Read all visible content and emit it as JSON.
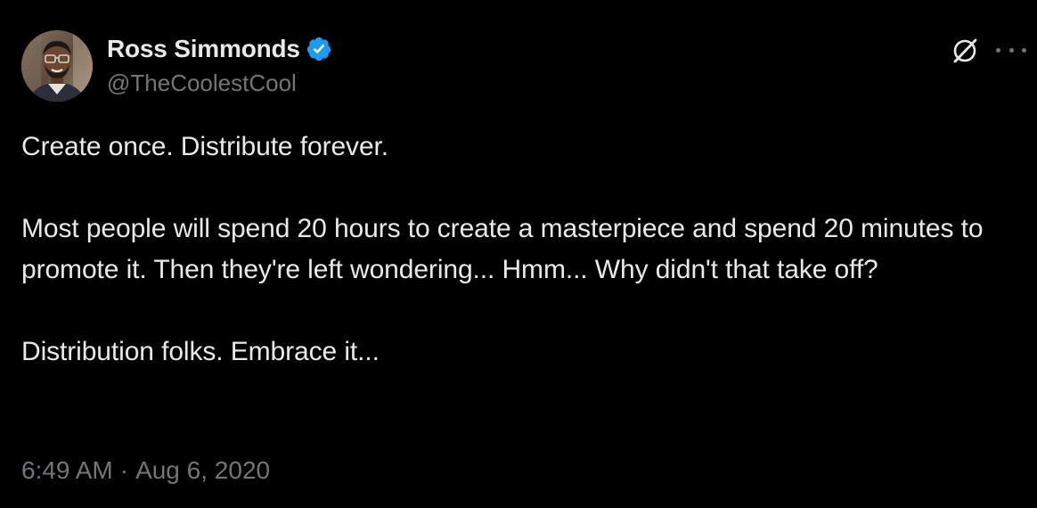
{
  "author": {
    "display_name": "Ross Simmonds",
    "handle": "@TheCoolestCool",
    "verified": true,
    "verified_color": "#1d9bf0"
  },
  "icons": {
    "grok": "grok-icon",
    "more": "more-options-icon",
    "verified": "verified-badge-icon"
  },
  "tweet": {
    "paragraphs": [
      "Create once. Distribute forever.",
      "Most people will spend 20 hours to create a masterpiece and spend 20 minutes to promote it. Then they're left wondering... Hmm... Why didn't that take off?",
      "Distribution folks. Embrace it..."
    ]
  },
  "meta": {
    "time": "6:49 AM",
    "separator": "·",
    "date": "Aug 6, 2020"
  },
  "colors": {
    "background": "#000000",
    "text_primary": "#e7e9ea",
    "text_secondary": "#71767b"
  }
}
